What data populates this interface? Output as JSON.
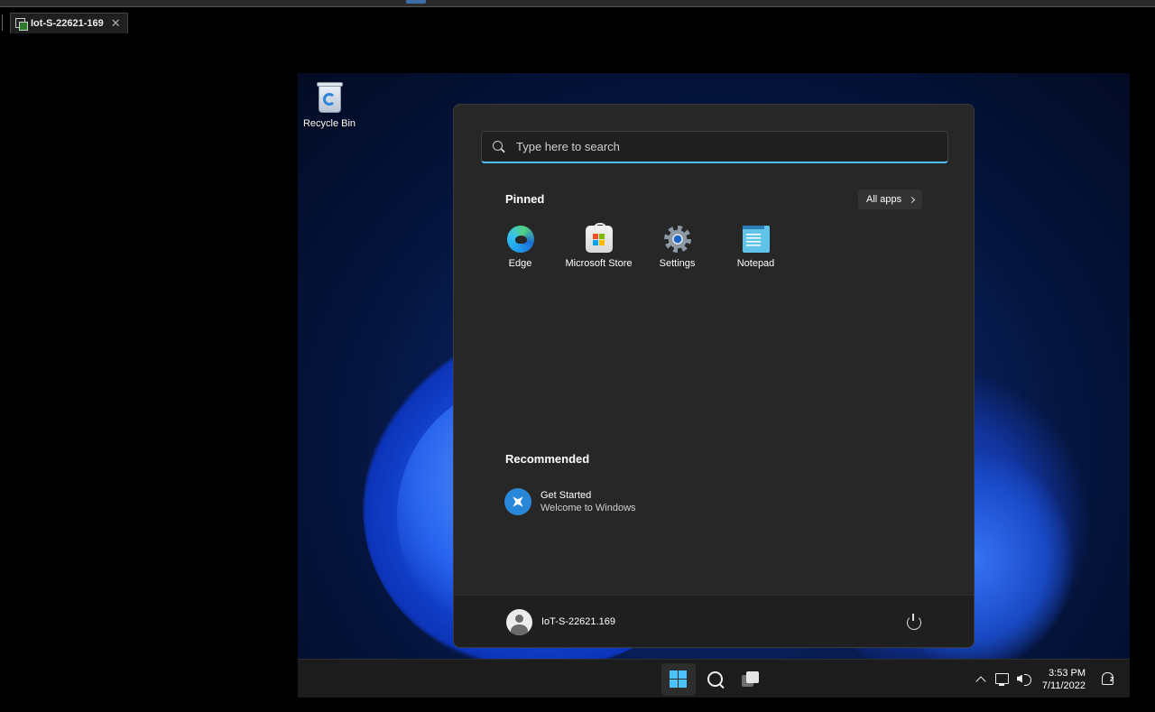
{
  "host": {
    "tab_title": "Iot-S-22621-169",
    "tab_close": "✕"
  },
  "desktop": {
    "icons": [
      {
        "label": "Recycle Bin",
        "icon": "recycle-bin-icon"
      }
    ]
  },
  "start_menu": {
    "search_placeholder": "Type here to search",
    "pinned_title": "Pinned",
    "all_apps_label": "All apps",
    "pinned_apps": [
      {
        "label": "Edge",
        "icon": "edge-icon"
      },
      {
        "label": "Microsoft Store",
        "icon": "microsoft-store-icon"
      },
      {
        "label": "Settings",
        "icon": "settings-gear-icon"
      },
      {
        "label": "Notepad",
        "icon": "notepad-icon"
      }
    ],
    "recommended_title": "Recommended",
    "recommended": [
      {
        "title": "Get Started",
        "subtitle": "Welcome to Windows",
        "icon": "get-started-icon"
      }
    ],
    "user_name": "IoT-S-22621.169",
    "accent_color": "#4cc2ff"
  },
  "taskbar": {
    "time": "3:53 PM",
    "date": "7/11/2022"
  }
}
